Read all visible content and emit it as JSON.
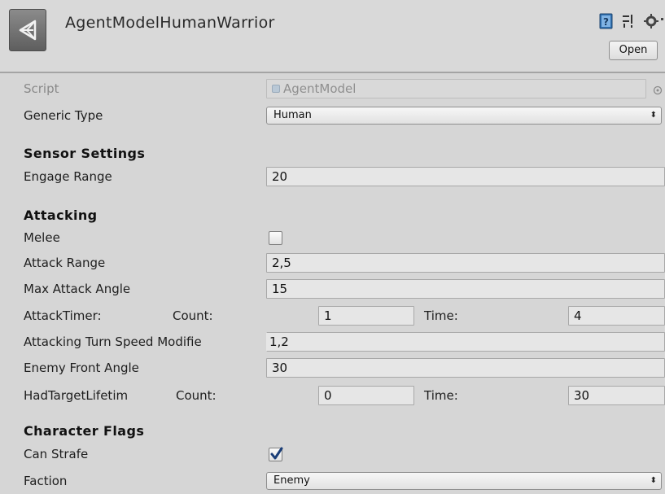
{
  "header": {
    "title": "AgentModelHumanWarrior",
    "open_label": "Open",
    "icons": [
      "help-book-icon",
      "preset-sliders-icon",
      "gear-icon"
    ]
  },
  "script": {
    "label": "Script",
    "value": "AgentModel"
  },
  "generic_type": {
    "label": "Generic Type",
    "value": "Human"
  },
  "sensor_settings": {
    "header": "Sensor Settings",
    "engage_range": {
      "label": "Engage Range",
      "value": "20"
    }
  },
  "attacking": {
    "header": "Attacking",
    "melee": {
      "label": "Melee",
      "checked": false
    },
    "attack_range": {
      "label": "Attack Range",
      "value": "2,5"
    },
    "max_attack_angle": {
      "label": "Max Attack Angle",
      "value": "15"
    },
    "attack_timer": {
      "label": "AttackTimer:",
      "count_label": "Count:",
      "count_value": "1",
      "time_label": "Time:",
      "time_value": "4"
    },
    "turn_speed_modifier": {
      "label": "Attacking Turn Speed Modifie",
      "value": "1,2"
    },
    "enemy_front_angle": {
      "label": "Enemy Front Angle",
      "value": "30"
    },
    "had_target_lifetime": {
      "label": "HadTargetLifetim",
      "count_label": "Count:",
      "count_value": "0",
      "time_label": "Time:",
      "time_value": "30"
    }
  },
  "character_flags": {
    "header": "Character Flags",
    "can_strafe": {
      "label": "Can Strafe",
      "checked": true
    },
    "faction": {
      "label": "Faction",
      "value": "Enemy"
    }
  },
  "colors": {
    "background": "#d6d6d6",
    "field_background": "#e6e6e6",
    "disabled_text": "#8a8a8a"
  }
}
